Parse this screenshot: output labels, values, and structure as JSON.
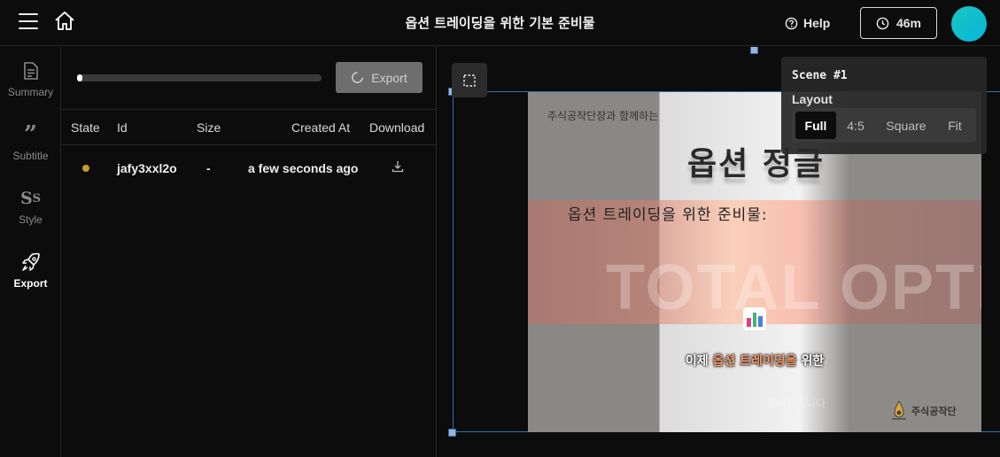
{
  "header": {
    "title": "옵션 트레이딩을 위한 기본 준비물",
    "help_label": "Help",
    "timer_label": "46m",
    "avatar_color": "#0fbfd0"
  },
  "sidebar": {
    "items": [
      {
        "label": "Summary",
        "icon": "document-icon"
      },
      {
        "label": "Subtitle",
        "icon": "quote-icon"
      },
      {
        "label": "Style",
        "icon": "style-icon"
      },
      {
        "label": "Export",
        "icon": "rocket-icon",
        "active": true
      }
    ]
  },
  "export_panel": {
    "progress_fraction": 0.02,
    "export_button_label": "Export",
    "columns": [
      "State",
      "Id",
      "Size",
      "Created At",
      "Download"
    ],
    "rows": [
      {
        "state_color": "#c99a2e",
        "id": "jafy3xxl2o",
        "size": "-",
        "created_at": "a few seconds ago",
        "download_icon": "download-icon"
      }
    ]
  },
  "preview": {
    "brand_text": "주식공작단장과 함께하는",
    "headline": "옵션 정글",
    "subheadline": "옵션 트레이딩을 위한 준비물:",
    "background_text": "TOTAL OPTIONS",
    "caption_prefix": "이제 ",
    "caption_highlight": "옵션 트레이딩을",
    "caption_suffix": " 위한",
    "faint_text": "준비물입니다",
    "logo_text": "주식공작단"
  },
  "scene_panel": {
    "title": "Scene #1",
    "layout_label": "Layout",
    "options": [
      "Full",
      "4:5",
      "Square",
      "Fit"
    ],
    "selected": "Full"
  }
}
